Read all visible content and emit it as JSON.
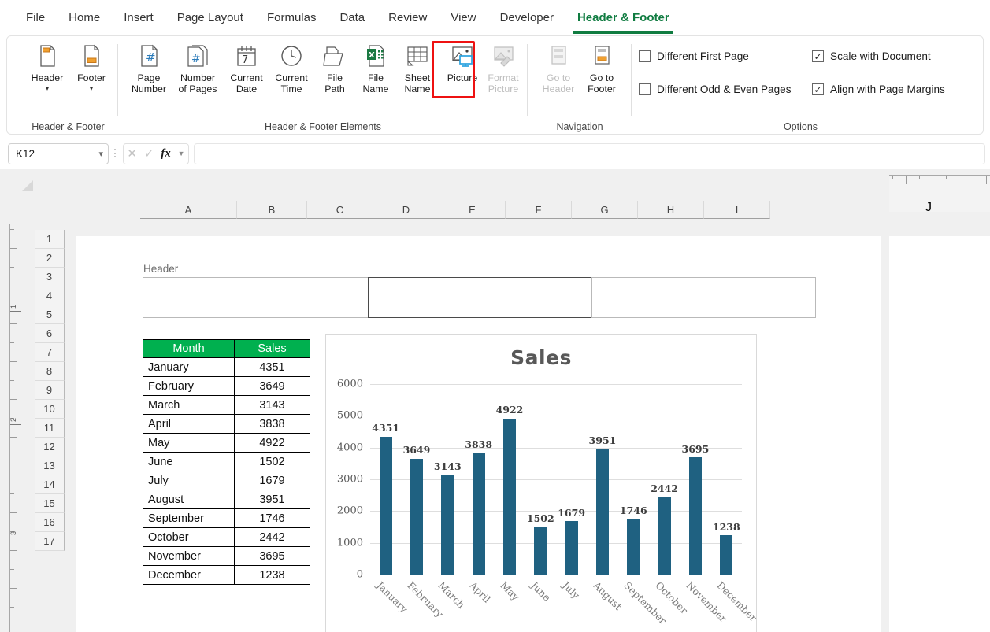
{
  "ribbon": {
    "tabs": [
      {
        "label": "File",
        "active": false
      },
      {
        "label": "Home",
        "active": false
      },
      {
        "label": "Insert",
        "active": false
      },
      {
        "label": "Page Layout",
        "active": false
      },
      {
        "label": "Formulas",
        "active": false
      },
      {
        "label": "Data",
        "active": false
      },
      {
        "label": "Review",
        "active": false
      },
      {
        "label": "View",
        "active": false
      },
      {
        "label": "Developer",
        "active": false
      },
      {
        "label": "Header & Footer",
        "active": true
      }
    ],
    "groups": {
      "header_footer": {
        "label": "Header & Footer",
        "buttons": [
          {
            "label": "Header",
            "icon": "header-page-icon",
            "has_caret": true
          },
          {
            "label": "Footer",
            "icon": "footer-page-icon",
            "has_caret": true
          }
        ]
      },
      "elements": {
        "label": "Header & Footer Elements",
        "buttons": [
          {
            "label": "Page\nNumber",
            "l1": "Page",
            "l2": "Number",
            "icon": "page-number-icon",
            "disabled": false
          },
          {
            "label": "Number of Pages",
            "l1": "Number",
            "l2": "of Pages",
            "icon": "number-of-pages-icon",
            "disabled": false
          },
          {
            "label": "Current Date",
            "l1": "Current",
            "l2": "Date",
            "icon": "calendar-icon",
            "disabled": false
          },
          {
            "label": "Current Time",
            "l1": "Current",
            "l2": "Time",
            "icon": "clock-icon",
            "disabled": false
          },
          {
            "label": "File Path",
            "l1": "File",
            "l2": "Path",
            "icon": "file-path-icon",
            "disabled": false
          },
          {
            "label": "File Name",
            "l1": "File",
            "l2": "Name",
            "icon": "file-name-icon",
            "disabled": false
          },
          {
            "label": "Sheet Name",
            "l1": "Sheet",
            "l2": "Name",
            "icon": "sheet-name-icon",
            "disabled": false
          },
          {
            "label": "Picture",
            "l1": "Picture",
            "l2": "",
            "icon": "picture-icon",
            "disabled": false,
            "highlighted": true
          },
          {
            "label": "Format Picture",
            "l1": "Format",
            "l2": "Picture",
            "icon": "format-picture-icon",
            "disabled": true
          }
        ]
      },
      "navigation": {
        "label": "Navigation",
        "buttons": [
          {
            "label": "Go to Header",
            "l1": "Go to",
            "l2": "Header",
            "icon": "go-to-header-icon",
            "disabled": true
          },
          {
            "label": "Go to Footer",
            "l1": "Go to",
            "l2": "Footer",
            "icon": "go-to-footer-icon",
            "disabled": false
          }
        ]
      },
      "options": {
        "label": "Options",
        "checkboxes": [
          {
            "label": "Different First Page",
            "checked": false
          },
          {
            "label": "Different Odd & Even Pages",
            "checked": false
          },
          {
            "label": "Scale with Document",
            "checked": true
          },
          {
            "label": "Align with Page Margins",
            "checked": true
          }
        ]
      }
    }
  },
  "formula_bar": {
    "name_box_value": "K12",
    "name_box_placeholder": "Name Box",
    "cancel_icon": "cancel-icon",
    "enter_icon": "enter-icon",
    "fx_icon": "fx-icon",
    "formula_value": "",
    "formula_placeholder": ""
  },
  "grid": {
    "columns": [
      "A",
      "B",
      "C",
      "D",
      "E",
      "F",
      "G",
      "H",
      "I"
    ],
    "columns_right": [
      "J"
    ],
    "rows": [
      "1",
      "2",
      "3",
      "4",
      "5",
      "6",
      "7",
      "8",
      "9",
      "10",
      "11",
      "12",
      "13",
      "14",
      "15",
      "16",
      "17"
    ],
    "vertical_ruler_marks": [
      "1",
      "2",
      "3"
    ]
  },
  "page_header": {
    "label": "Header",
    "sections": [
      {
        "name": "left",
        "value": "",
        "active": false
      },
      {
        "name": "center",
        "value": "",
        "active": true
      },
      {
        "name": "right",
        "value": "",
        "active": false
      }
    ]
  },
  "table": {
    "headers": [
      "Month",
      "Sales"
    ],
    "header_bg": "#00b04f",
    "rows": [
      [
        "January",
        "4351"
      ],
      [
        "February",
        "3649"
      ],
      [
        "March",
        "3143"
      ],
      [
        "April",
        "3838"
      ],
      [
        "May",
        "4922"
      ],
      [
        "June",
        "1502"
      ],
      [
        "July",
        "1679"
      ],
      [
        "August",
        "3951"
      ],
      [
        "September",
        "1746"
      ],
      [
        "October",
        "2442"
      ],
      [
        "November",
        "3695"
      ],
      [
        "December",
        "1238"
      ]
    ]
  },
  "chart_data": {
    "type": "bar",
    "title": "Sales",
    "xlabel": "",
    "ylabel": "",
    "categories": [
      "January",
      "February",
      "March",
      "April",
      "May",
      "June",
      "July",
      "August",
      "September",
      "October",
      "November",
      "December"
    ],
    "values": [
      4351,
      3649,
      3143,
      3838,
      4922,
      1502,
      1679,
      3951,
      1746,
      2442,
      3695,
      1238
    ],
    "data_labels": [
      "4351",
      "3649",
      "3143",
      "3838",
      "4922",
      "1502",
      "1679",
      "3951",
      "1746",
      "2442",
      "3695",
      "1238"
    ],
    "yticks": [
      0,
      1000,
      2000,
      3000,
      4000,
      5000,
      6000
    ],
    "ytick_labels": [
      "0",
      "1000",
      "2000",
      "3000",
      "4000",
      "5000",
      "6000"
    ],
    "ylim": [
      0,
      6000
    ],
    "grid": true,
    "legend": false,
    "series_color": "#1f6181",
    "title_color": "#585858"
  }
}
